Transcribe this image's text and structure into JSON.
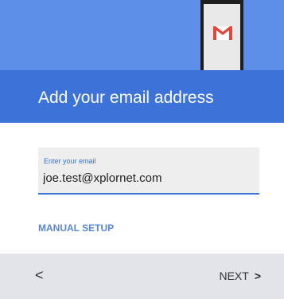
{
  "header": {
    "title": "Add your email address"
  },
  "email_field": {
    "label": "Enter your email",
    "value": "joe.test@xplornet.com"
  },
  "links": {
    "manual_setup": "MANUAL SETUP"
  },
  "footer": {
    "back_glyph": "<",
    "next_label": "NEXT",
    "next_glyph": ">"
  },
  "colors": {
    "banner": "#5d8ee8",
    "header": "#3d72d9",
    "accent": "#3d72d9",
    "footer": "#e3e4e9",
    "gmail_red": "#e0463a"
  },
  "icons": {
    "phone": "phone-illustration",
    "gmail": "gmail-icon"
  }
}
